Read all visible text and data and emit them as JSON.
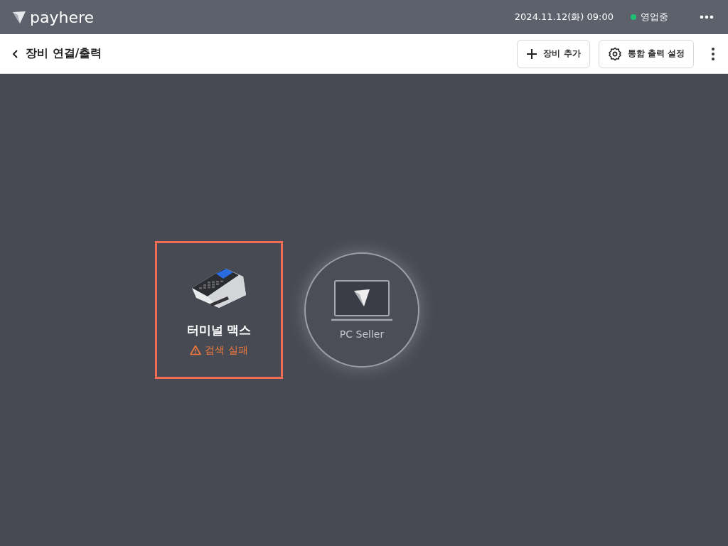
{
  "top_bar": {
    "logo": "payhere",
    "datetime": "2024.11.12(화) 09:00",
    "store_status": {
      "label": "영업중",
      "color": "#1dbf73"
    }
  },
  "header": {
    "title": "장비 연결/출력",
    "buttons": [
      {
        "kind": "add",
        "label": "장비 추가"
      },
      {
        "kind": "settings",
        "label": "통합 출력 설정"
      }
    ]
  },
  "devices": [
    {
      "kind": "terminal",
      "name": "터미널 맥스",
      "status": "검색 실패",
      "error": true
    },
    {
      "kind": "pc",
      "name": "PC Seller",
      "error": false
    }
  ]
}
